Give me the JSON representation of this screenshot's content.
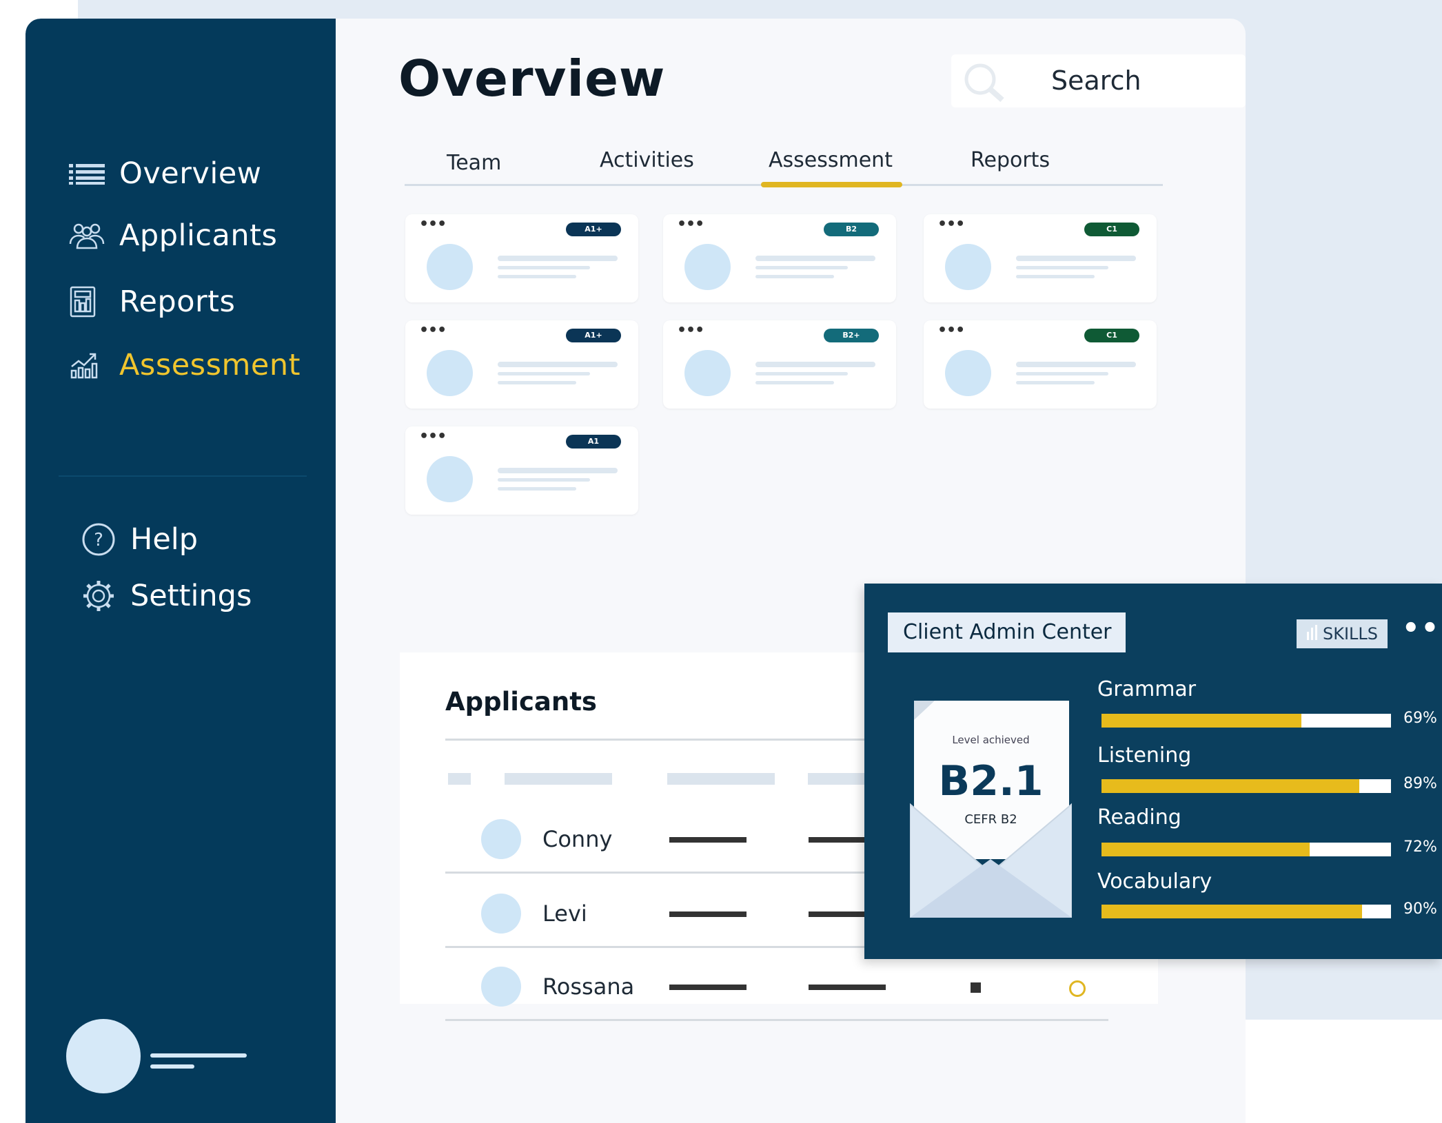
{
  "sidebar": {
    "nav": [
      {
        "label": "Overview",
        "icon": "list-icon"
      },
      {
        "label": "Applicants",
        "icon": "users-icon"
      },
      {
        "label": "Reports",
        "icon": "report-icon"
      },
      {
        "label": "Assessment",
        "icon": "chart-icon",
        "active": true
      }
    ],
    "secondary": [
      {
        "label": "Help",
        "icon": "help-icon"
      },
      {
        "label": "Settings",
        "icon": "gear-icon"
      }
    ]
  },
  "header": {
    "title": "Overview",
    "search_placeholder": "Search"
  },
  "tabs": [
    {
      "label": "Team"
    },
    {
      "label": "Activities"
    },
    {
      "label": "Assessment",
      "active": true
    },
    {
      "label": "Reports"
    }
  ],
  "cards": [
    {
      "badge": "A1+",
      "badge_color": "#0b3556"
    },
    {
      "badge": "B2",
      "badge_color": "#136b7a"
    },
    {
      "badge": "C1",
      "badge_color": "#0f5a35"
    },
    {
      "badge": "A1+",
      "badge_color": "#0b3556"
    },
    {
      "badge": "B2+",
      "badge_color": "#136b7a"
    },
    {
      "badge": "C1",
      "badge_color": "#0f5a35"
    },
    {
      "badge": "A1",
      "badge_color": "#0b3556"
    }
  ],
  "applicants": {
    "title": "Applicants",
    "rows": [
      {
        "name": "Conny"
      },
      {
        "name": "Levi"
      },
      {
        "name": "Rossana"
      }
    ]
  },
  "popup": {
    "title": "Client Admin Center",
    "skills_button": "SKILLS",
    "more": "•••",
    "letter": {
      "caption": "Level achieved",
      "level": "B2.1",
      "cefr": "CEFR B2"
    },
    "skills": [
      {
        "name": "Grammar",
        "value": 69,
        "label": "69%"
      },
      {
        "name": "Listening",
        "value": 89,
        "label": "89%"
      },
      {
        "name": "Reading",
        "value": 72,
        "label": "72%"
      },
      {
        "name": "Vocabulary",
        "value": 90,
        "label": "90%"
      }
    ]
  },
  "colors": {
    "sidebar": "#043a5b",
    "accent": "#f0c52e",
    "popup": "#0b3f5e"
  }
}
